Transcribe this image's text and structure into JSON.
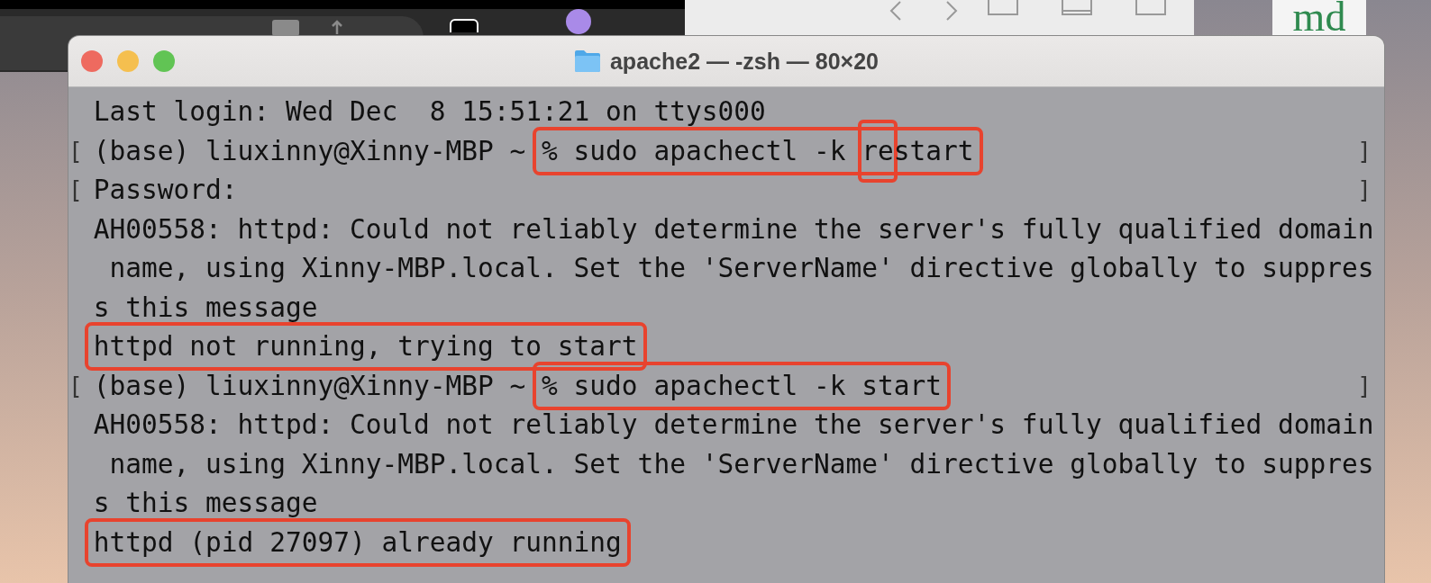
{
  "background_window": {
    "logo": "md"
  },
  "window": {
    "title": "apache2 — -zsh — 80×20"
  },
  "lines": [
    {
      "segments": [
        {
          "text": "Last login: Wed Dec  8 15:51:21 on ttys000",
          "boxed": false
        }
      ]
    },
    {
      "open": "[",
      "close": "]",
      "segments": [
        {
          "text": "(base) liuxinny@Xinny-MBP ~ ",
          "boxed": false
        },
        {
          "boxed": true,
          "parts": [
            {
              "text": "% sudo apachectl -k ",
              "boxed": false
            },
            {
              "text": "re",
              "boxed": true
            },
            {
              "text": "start",
              "boxed": false
            }
          ]
        }
      ]
    },
    {
      "open": "[",
      "close": "]",
      "segments": [
        {
          "text": "Password:",
          "boxed": false
        }
      ]
    },
    {
      "segments": [
        {
          "text": "AH00558: httpd: Could not reliably determine the server's fully qualified domain",
          "boxed": false
        }
      ]
    },
    {
      "segments": [
        {
          "text": " name, using Xinny-MBP.local. Set the 'ServerName' directive globally to suppres",
          "boxed": false
        }
      ]
    },
    {
      "segments": [
        {
          "text": "s this message",
          "boxed": false
        }
      ]
    },
    {
      "segments": [
        {
          "text": "httpd not running, trying to start",
          "boxed": true
        }
      ]
    },
    {
      "open": "[",
      "close": "]",
      "segments": [
        {
          "text": "(base) liuxinny@Xinny-MBP ~ ",
          "boxed": false
        },
        {
          "text": "% sudo apachectl -k start",
          "boxed": true
        }
      ]
    },
    {
      "segments": [
        {
          "text": "AH00558: httpd: Could not reliably determine the server's fully qualified domain",
          "boxed": false
        }
      ]
    },
    {
      "segments": [
        {
          "text": " name, using Xinny-MBP.local. Set the 'ServerName' directive globally to suppres",
          "boxed": false
        }
      ]
    },
    {
      "segments": [
        {
          "text": "s this message",
          "boxed": false
        }
      ]
    },
    {
      "segments": [
        {
          "text": "httpd (pid 27097) already running",
          "boxed": true
        }
      ]
    }
  ]
}
